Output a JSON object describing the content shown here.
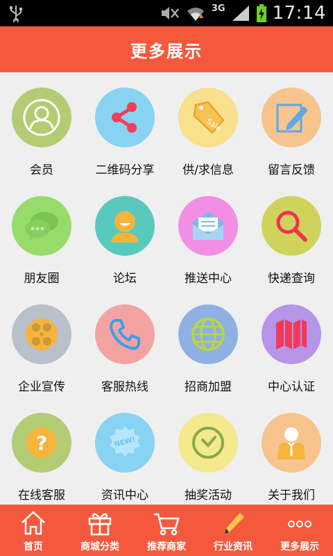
{
  "status_bar": {
    "network": "3G",
    "time": "17:14"
  },
  "header": {
    "title": "更多展示"
  },
  "grid_items": [
    {
      "label": "会员",
      "color": "#b2cc73",
      "icon": "user-icon"
    },
    {
      "label": "二维码分享",
      "color": "#88d3f2",
      "icon": "share-icon"
    },
    {
      "label": "供/求信息",
      "color": "#f9e08b",
      "icon": "sale-tag-icon"
    },
    {
      "label": "留言反馈",
      "color": "#f7c48e",
      "icon": "edit-note-icon"
    },
    {
      "label": "朋友圈",
      "color": "#97dc6b",
      "icon": "chat-bubbles-icon"
    },
    {
      "label": "论坛",
      "color": "#59c9be",
      "icon": "forum-person-icon"
    },
    {
      "label": "推送中心",
      "color": "#f28ee4",
      "icon": "mail-icon"
    },
    {
      "label": "快递查询",
      "color": "#cfd35b",
      "icon": "magnifier-icon"
    },
    {
      "label": "企业宣传",
      "color": "#b8c0ca",
      "icon": "film-reel-icon"
    },
    {
      "label": "客服热线",
      "color": "#f4a3a3",
      "icon": "phone-icon"
    },
    {
      "label": "招商加盟",
      "color": "#8fb0e2",
      "icon": "globe-icon"
    },
    {
      "label": "中心认证",
      "color": "#b694e8",
      "icon": "map-icon"
    },
    {
      "label": "在线客服",
      "color": "#b2cc73",
      "icon": "question-icon"
    },
    {
      "label": "资讯中心",
      "color": "#88d3f2",
      "icon": "new-badge-icon"
    },
    {
      "label": "抽奖活动",
      "color": "#f3e98d",
      "icon": "clock-icon"
    },
    {
      "label": "关于我们",
      "color": "#f7c48e",
      "icon": "business-person-icon"
    }
  ],
  "bottom_nav": [
    {
      "label": "首页",
      "icon": "home-icon"
    },
    {
      "label": "商城分类",
      "icon": "gift-icon"
    },
    {
      "label": "推荐商家",
      "icon": "cart-icon"
    },
    {
      "label": "行业资讯",
      "icon": "pencil-icon"
    },
    {
      "label": "更多展示",
      "icon": "more-dots-icon"
    }
  ]
}
